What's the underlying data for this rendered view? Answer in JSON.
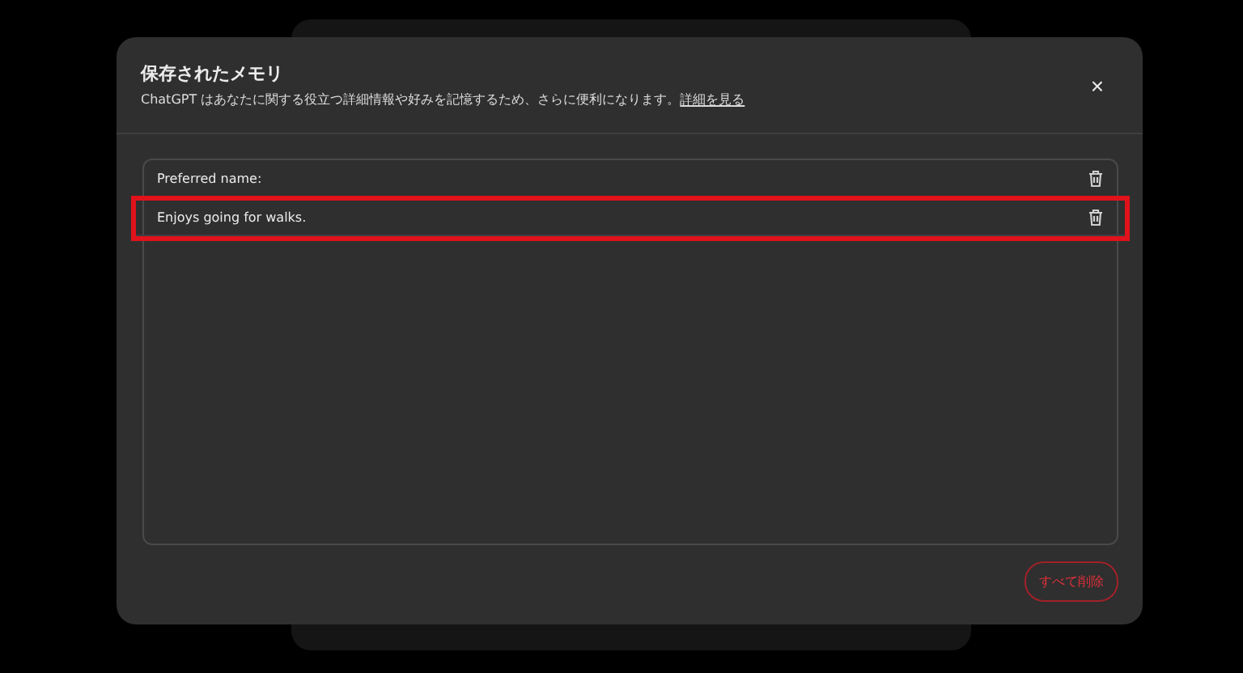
{
  "dialog": {
    "title": "保存されたメモリ",
    "description": "ChatGPT はあなたに関する役立つ詳細情報や好みを記憶するため、さらに便利になります。",
    "link": "詳細を見る",
    "close": "×"
  },
  "memories": [
    {
      "text": "Preferred name:",
      "highlighted": false
    },
    {
      "text": "Enjoys going for walks.",
      "highlighted": true
    }
  ],
  "delete_all": "すべて削除"
}
